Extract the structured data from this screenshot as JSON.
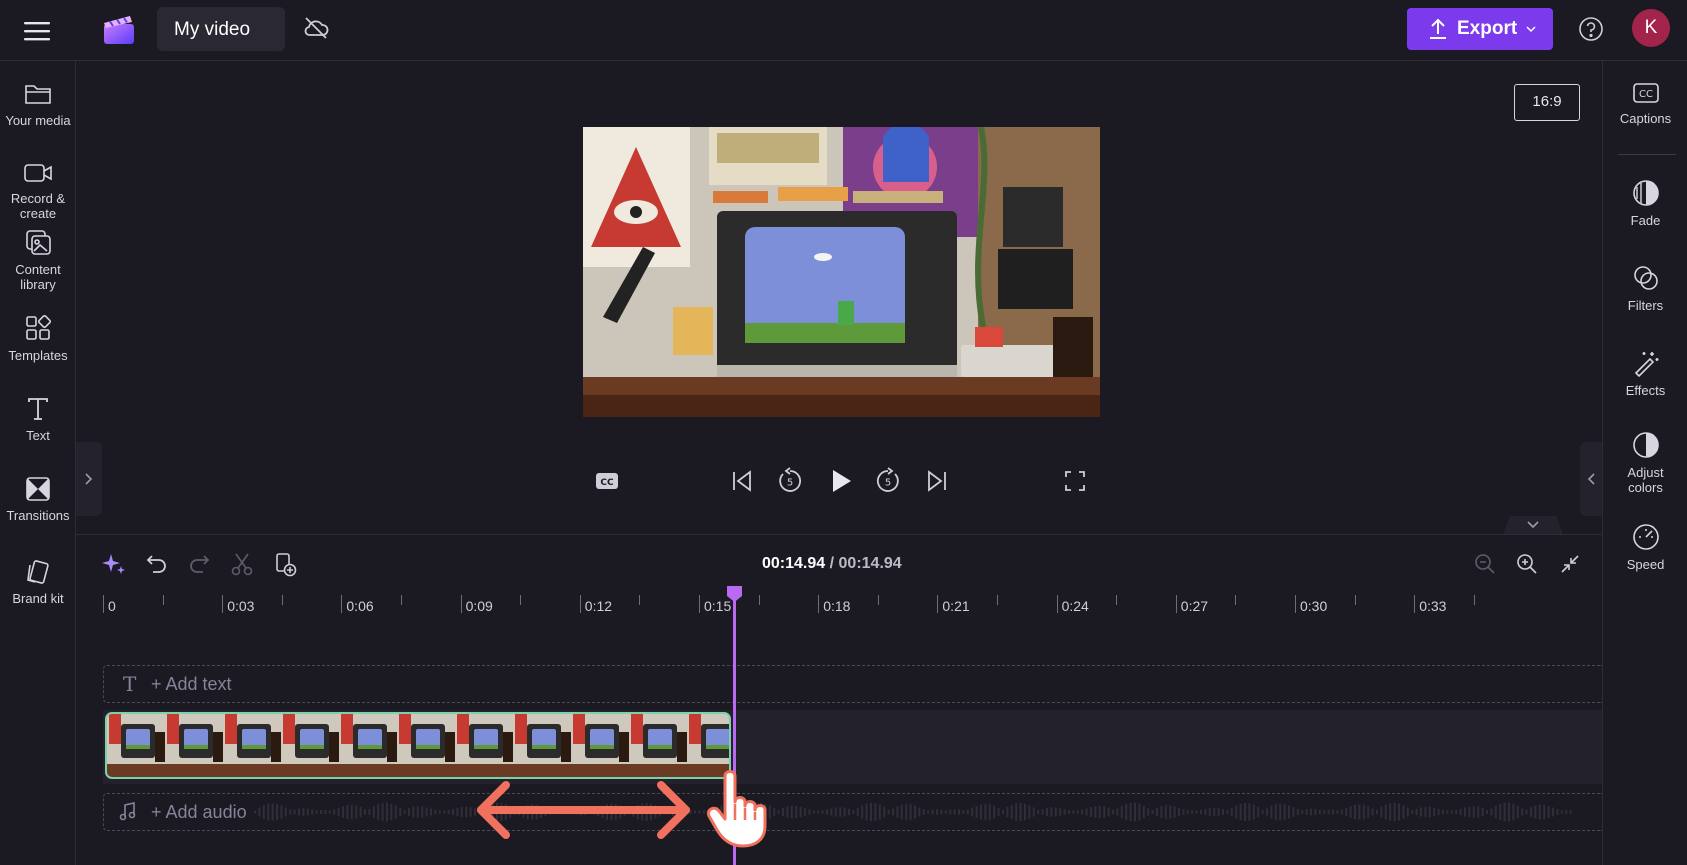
{
  "header": {
    "menu_icon": "hamburger-menu-icon",
    "logo_icon": "clipchamp-logo-icon",
    "project_title": "My video",
    "cloud_status_icon": "cloud-off-icon",
    "export_label": "Export",
    "help_icon": "help-icon",
    "avatar_initial": "K",
    "accent_color": "#7c3aed",
    "avatar_color": "#a3244a"
  },
  "left_sidebar": {
    "items": [
      {
        "label": "Your media",
        "icon": "folder-icon"
      },
      {
        "label": "Record & create",
        "icon": "video-camera-icon"
      },
      {
        "label": "Content library",
        "icon": "content-library-icon"
      },
      {
        "label": "Templates",
        "icon": "templates-icon"
      },
      {
        "label": "Text",
        "icon": "text-icon"
      },
      {
        "label": "Transitions",
        "icon": "transitions-icon"
      },
      {
        "label": "Brand kit",
        "icon": "brand-kit-icon"
      }
    ]
  },
  "right_sidebar": {
    "items": [
      {
        "label": "Captions",
        "icon": "captions-icon"
      },
      {
        "label": "Fade",
        "icon": "fade-icon"
      },
      {
        "label": "Filters",
        "icon": "filters-icon"
      },
      {
        "label": "Effects",
        "icon": "effects-icon"
      },
      {
        "label": "Adjust colors",
        "icon": "adjust-colors-icon"
      },
      {
        "label": "Speed",
        "icon": "speed-icon"
      }
    ]
  },
  "preview": {
    "aspect_ratio": "16:9",
    "controls": [
      "captions-toggle-icon",
      "skip-to-start-icon",
      "rewind-5-icon",
      "play-icon",
      "forward-5-icon",
      "skip-to-end-icon",
      "fullscreen-icon"
    ]
  },
  "timeline": {
    "current_time": "00:14.94",
    "separator": " / ",
    "total_time": "00:14.94",
    "ruler": [
      "0",
      "0:03",
      "0:06",
      "0:09",
      "0:12",
      "0:15",
      "0:18",
      "0:21",
      "0:24",
      "0:27",
      "0:30",
      "0:33"
    ],
    "add_text_label": "+ Add text",
    "add_audio_label": "+ Add audio",
    "clip_border_color": "#7ad3a8",
    "playhead_color": "#b86bf2",
    "annotation_arrow_color": "#f2705e"
  }
}
